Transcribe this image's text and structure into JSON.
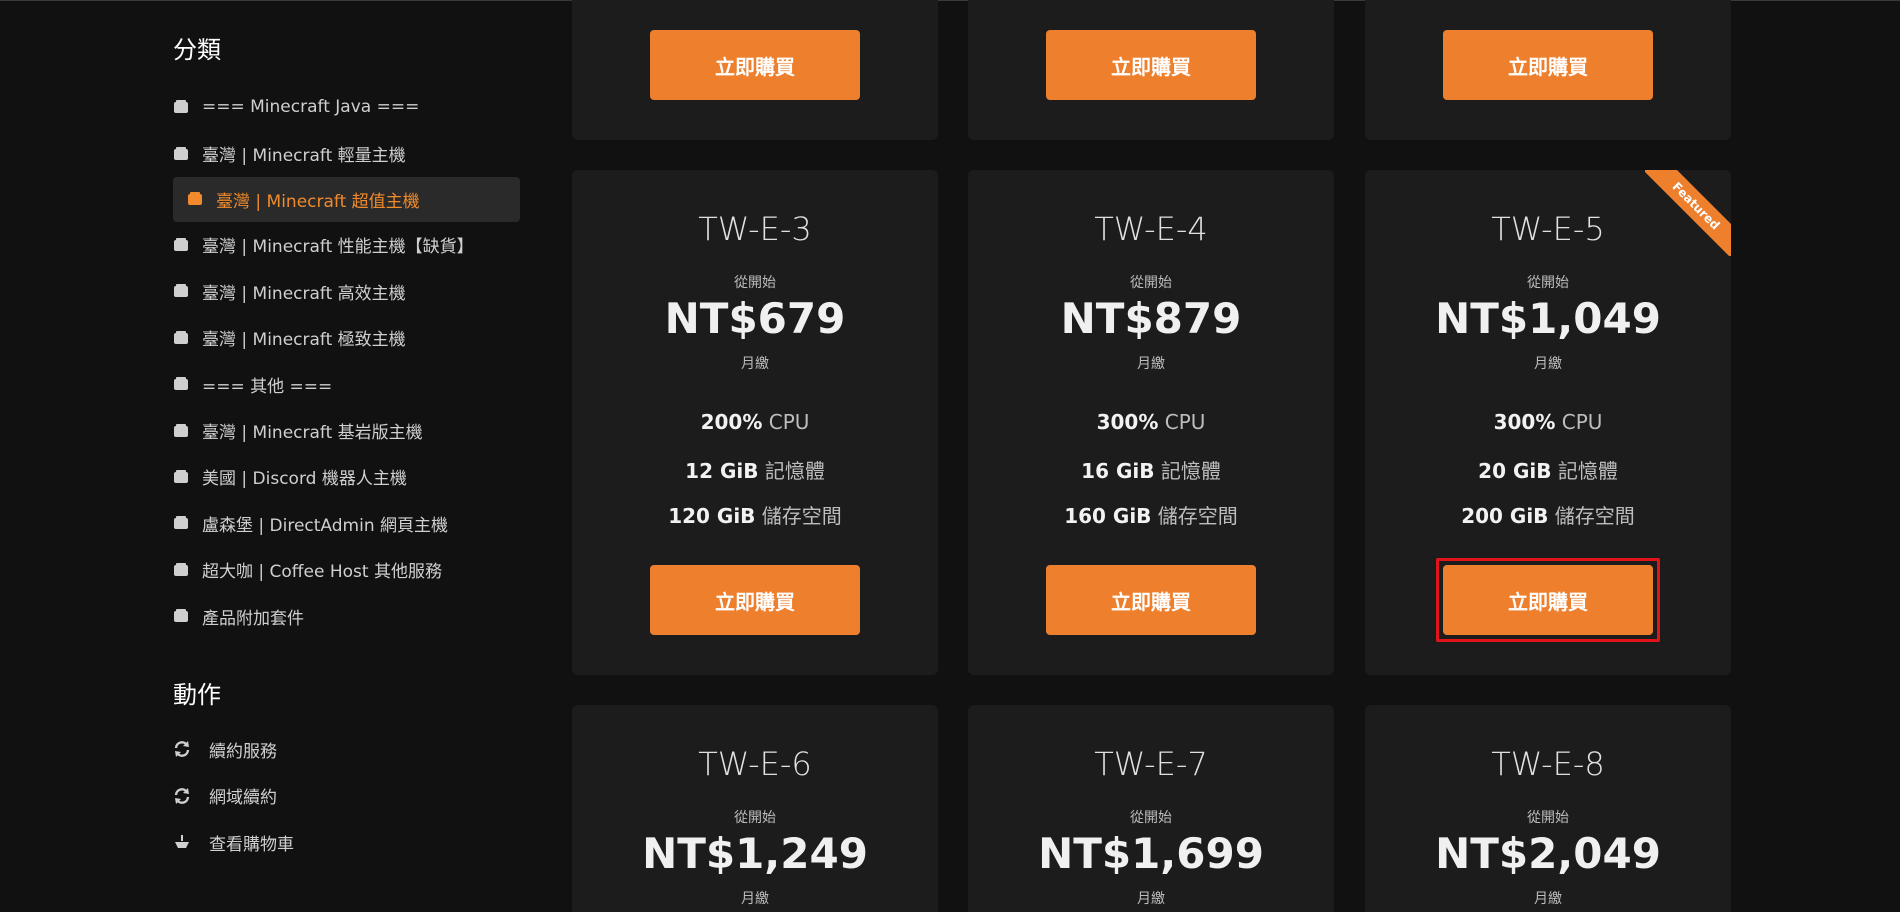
{
  "sidebar": {
    "categories_heading": "分類",
    "categories": [
      {
        "label": "=== Minecraft Java ===",
        "active": false
      },
      {
        "label": "臺灣 | Minecraft 輕量主機",
        "active": false
      },
      {
        "label": "臺灣 | Minecraft 超值主機",
        "active": true
      },
      {
        "label": "臺灣 | Minecraft 性能主機【缺貨】",
        "active": false
      },
      {
        "label": "臺灣 | Minecraft 高效主機",
        "active": false
      },
      {
        "label": "臺灣 | Minecraft 極致主機",
        "active": false
      },
      {
        "label": "=== 其他 ===",
        "active": false
      },
      {
        "label": "臺灣 | Minecraft 基岩版主機",
        "active": false
      },
      {
        "label": "美國 | Discord 機器人主機",
        "active": false
      },
      {
        "label": "盧森堡 | DirectAdmin 網頁主機",
        "active": false
      },
      {
        "label": "超大咖 | Coffee Host 其他服務",
        "active": false
      },
      {
        "label": "產品附加套件",
        "active": false
      }
    ],
    "actions_heading": "動作",
    "actions": [
      {
        "label": "續約服務",
        "icon": "sync-icon"
      },
      {
        "label": "網域續約",
        "icon": "sync-icon"
      },
      {
        "label": "查看購物車",
        "icon": "cart-icon"
      }
    ]
  },
  "buy_label": "立即購買",
  "from_label": "從開始",
  "cycle_label": "月繳",
  "featured_label": "Featured",
  "products": [
    {
      "name": "TW-E-3",
      "price": "NT$679",
      "cpu": "200%",
      "cpu_unit": "CPU",
      "ram": "12 GiB",
      "ram_unit": "記憶體",
      "disk": "120 GiB",
      "disk_unit": "儲存空間",
      "featured": false
    },
    {
      "name": "TW-E-4",
      "price": "NT$879",
      "cpu": "300%",
      "cpu_unit": "CPU",
      "ram": "16 GiB",
      "ram_unit": "記憶體",
      "disk": "160 GiB",
      "disk_unit": "儲存空間",
      "featured": false
    },
    {
      "name": "TW-E-5",
      "price": "NT$1,049",
      "cpu": "300%",
      "cpu_unit": "CPU",
      "ram": "20 GiB",
      "ram_unit": "記憶體",
      "disk": "200 GiB",
      "disk_unit": "儲存空間",
      "featured": true
    },
    {
      "name": "TW-E-6",
      "price": "NT$1,249"
    },
    {
      "name": "TW-E-7",
      "price": "NT$1,699"
    },
    {
      "name": "TW-E-8",
      "price": "NT$2,049"
    }
  ],
  "colors": {
    "accent": "#ee7f2d",
    "highlight": "#e1141a",
    "background": "#111111",
    "card": "#1c1c1c"
  }
}
